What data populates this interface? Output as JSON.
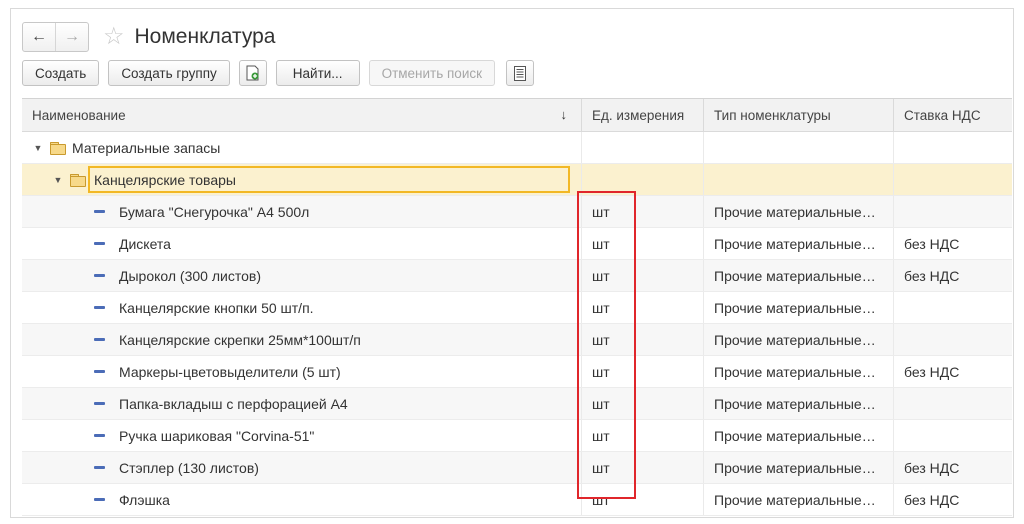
{
  "window": {
    "back_icon": "arrow-left",
    "forward_icon": "arrow-right",
    "favorite_icon": "star-outline",
    "title": "Номенклатура"
  },
  "toolbar": {
    "create_label": "Создать",
    "create_group_label": "Создать группу",
    "copy_icon": "new-document-plus",
    "find_label": "Найти...",
    "cancel_search_label": "Отменить поиск",
    "list_icon": "list-document"
  },
  "table": {
    "columns": [
      "Наименование",
      "Ед. измерения",
      "Тип номенклатуры",
      "Ставка НДС"
    ],
    "sort_indicator": "↓",
    "groups": [
      {
        "name": "Материальные запасы",
        "expanded_icon": "▼"
      },
      {
        "name": "Канцелярские товары",
        "expanded_icon": "▼"
      }
    ],
    "rows": [
      {
        "name": "Бумага \"Снегурочка\" А4 500л",
        "unit": "шт",
        "type": "Прочие материальные…",
        "vat": ""
      },
      {
        "name": "Дискета",
        "unit": "шт",
        "type": "Прочие материальные…",
        "vat": "без НДС"
      },
      {
        "name": "Дырокол (300 листов)",
        "unit": "шт",
        "type": "Прочие материальные…",
        "vat": "без НДС"
      },
      {
        "name": "Канцелярские кнопки 50 шт/п.",
        "unit": "шт",
        "type": "Прочие материальные…",
        "vat": ""
      },
      {
        "name": "Канцелярские скрепки 25мм*100шт/п",
        "unit": "шт",
        "type": "Прочие материальные…",
        "vat": ""
      },
      {
        "name": "Маркеры-цветовыделители (5 шт)",
        "unit": "шт",
        "type": "Прочие материальные…",
        "vat": "без НДС"
      },
      {
        "name": "Папка-вкладыш с перфорацией А4",
        "unit": "шт",
        "type": "Прочие материальные…",
        "vat": ""
      },
      {
        "name": "Ручка шариковая \"Corvina-51\"",
        "unit": "шт",
        "type": "Прочие материальные…",
        "vat": ""
      },
      {
        "name": "Стэплер (130 листов)",
        "unit": "шт",
        "type": "Прочие материальные…",
        "vat": "без НДС"
      },
      {
        "name": "Флэшка",
        "unit": "шт",
        "type": "Прочие материальные…",
        "vat": "без НДС"
      }
    ]
  },
  "colors": {
    "highlight_border": "#e0262b",
    "selected_row": "#fbf1cf",
    "selected_border": "#f2b825",
    "item_icon": "#4b6cb7"
  }
}
